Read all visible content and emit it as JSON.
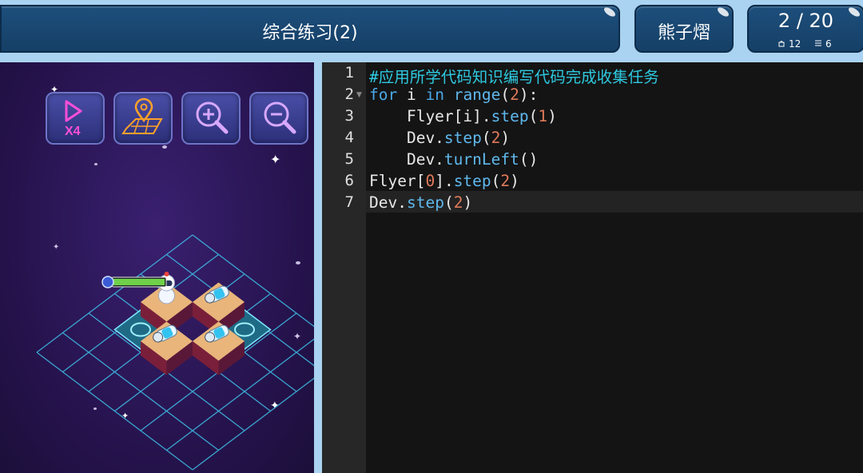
{
  "header": {
    "title": "综合练习(2)",
    "student_name": "熊子熠",
    "progress": "2 / 20",
    "stat_a_icon": "bag-icon",
    "stat_a_value": "12",
    "stat_b_icon": "list-icon",
    "stat_b_value": "6"
  },
  "toolbar": [
    {
      "name": "speed-x4-button",
      "icon": "play-x4-icon",
      "label": "X4"
    },
    {
      "name": "locate-map-button",
      "icon": "map-pin-icon"
    },
    {
      "name": "zoom-in-button",
      "icon": "zoom-in-icon"
    },
    {
      "name": "zoom-out-button",
      "icon": "zoom-out-icon"
    }
  ],
  "editor": {
    "line_numbers": [
      "1",
      "2",
      "3",
      "4",
      "5",
      "6",
      "7"
    ],
    "lines": [
      "#应用所学代码知识编写代码完成收集任务",
      "for i in range(2):",
      "    Flyer[i].step(1)",
      "    Dev.step(2)",
      "    Dev.turnLeft()",
      "Flyer[0].step(2)",
      "Dev.step(2)"
    ]
  },
  "colors": {
    "accent": "#1d4f7c",
    "keyword": "#4aa8e8",
    "number": "#e07a5a",
    "comment": "#2ec9e0",
    "health": "#6fd14a"
  }
}
